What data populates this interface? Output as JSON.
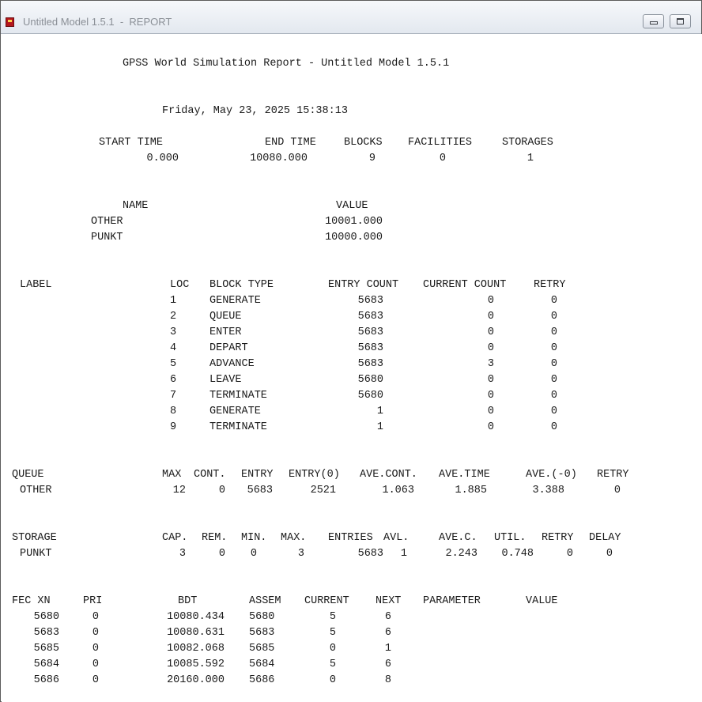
{
  "window": {
    "title": "Untitled Model 1.5.1  -  REPORT"
  },
  "report": {
    "title": "GPSS World Simulation Report - Untitled Model 1.5.1",
    "date": "Friday, May 23, 2025 15:38:13",
    "summary": {
      "headers": [
        "START TIME",
        "END TIME",
        "BLOCKS",
        "FACILITIES",
        "STORAGES"
      ],
      "values": [
        "0.000",
        "10080.000",
        "9",
        "0",
        "1"
      ]
    },
    "names": {
      "headers": [
        "NAME",
        "VALUE"
      ],
      "rows": [
        [
          "OTHER",
          "10001.000"
        ],
        [
          "PUNKT",
          "10000.000"
        ]
      ]
    },
    "blocks": {
      "headers": [
        "LABEL",
        "LOC",
        "BLOCK TYPE",
        "ENTRY COUNT",
        "CURRENT COUNT",
        "RETRY"
      ],
      "rows": [
        [
          "1",
          "GENERATE",
          "5683",
          "0",
          "0"
        ],
        [
          "2",
          "QUEUE",
          "5683",
          "0",
          "0"
        ],
        [
          "3",
          "ENTER",
          "5683",
          "0",
          "0"
        ],
        [
          "4",
          "DEPART",
          "5683",
          "0",
          "0"
        ],
        [
          "5",
          "ADVANCE",
          "5683",
          "3",
          "0"
        ],
        [
          "6",
          "LEAVE",
          "5680",
          "0",
          "0"
        ],
        [
          "7",
          "TERMINATE",
          "5680",
          "0",
          "0"
        ],
        [
          "8",
          "GENERATE",
          "1",
          "0",
          "0"
        ],
        [
          "9",
          "TERMINATE",
          "1",
          "0",
          "0"
        ]
      ]
    },
    "queue": {
      "headers": [
        "QUEUE",
        "MAX",
        "CONT.",
        "ENTRY",
        "ENTRY(0)",
        "AVE.CONT.",
        "AVE.TIME",
        "AVE.(-0)",
        "RETRY"
      ],
      "rows": [
        [
          "OTHER",
          "12",
          "0",
          "5683",
          "2521",
          "1.063",
          "1.885",
          "3.388",
          "0"
        ]
      ]
    },
    "storage": {
      "headers": [
        "STORAGE",
        "CAP.",
        "REM.",
        "MIN.",
        "MAX.",
        "ENTRIES",
        "AVL.",
        "AVE.C.",
        "UTIL.",
        "RETRY",
        "DELAY"
      ],
      "rows": [
        [
          "PUNKT",
          "3",
          "0",
          "0",
          "3",
          "5683",
          "1",
          "2.243",
          "0.748",
          "0",
          "0"
        ]
      ]
    },
    "fec": {
      "headers": [
        "FEC XN",
        "PRI",
        "BDT",
        "ASSEM",
        "CURRENT",
        "NEXT",
        "PARAMETER",
        "VALUE"
      ],
      "rows": [
        [
          "5680",
          "0",
          "10080.434",
          "5680",
          "5",
          "6"
        ],
        [
          "5683",
          "0",
          "10080.631",
          "5683",
          "5",
          "6"
        ],
        [
          "5685",
          "0",
          "10082.068",
          "5685",
          "0",
          "1"
        ],
        [
          "5684",
          "0",
          "10085.592",
          "5684",
          "5",
          "6"
        ],
        [
          "5686",
          "0",
          "20160.000",
          "5686",
          "0",
          "8"
        ]
      ]
    }
  }
}
